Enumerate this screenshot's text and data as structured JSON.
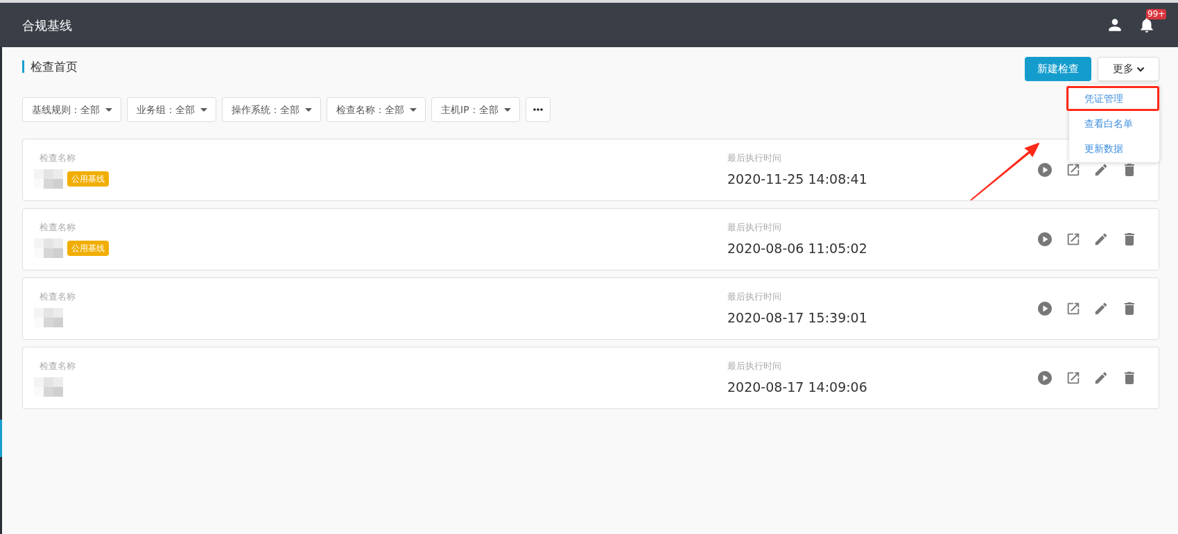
{
  "header": {
    "title": "合规基线",
    "notification_badge": "99+"
  },
  "page": {
    "title": "检查首页"
  },
  "actions": {
    "primary": "新建检查",
    "more": "更多",
    "menu_open": true,
    "menu": [
      {
        "label": "凭证管理",
        "annotated": true
      },
      {
        "label": "查看白名单",
        "annotated": false
      },
      {
        "label": "更新数据",
        "annotated": false
      }
    ]
  },
  "filters": [
    "基线规则：全部",
    "业务组：全部",
    "操作系统：全部",
    "检查名称：全部",
    "主机IP：全部"
  ],
  "checks": [
    {
      "name_label": "检查名称",
      "tag": "公用基线",
      "time_label": "最后执行时间",
      "time": "2020-11-25 14:08:41"
    },
    {
      "name_label": "检查名称",
      "tag": "公用基线",
      "time_label": "最后执行时间",
      "time": "2020-08-06 11:05:02"
    },
    {
      "name_label": "检查名称",
      "time_label": "最后执行时间",
      "time": "2020-08-17 15:39:01"
    },
    {
      "name_label": "检查名称",
      "time_label": "最后执行时间",
      "time": "2020-08-17 14:09:06"
    }
  ]
}
